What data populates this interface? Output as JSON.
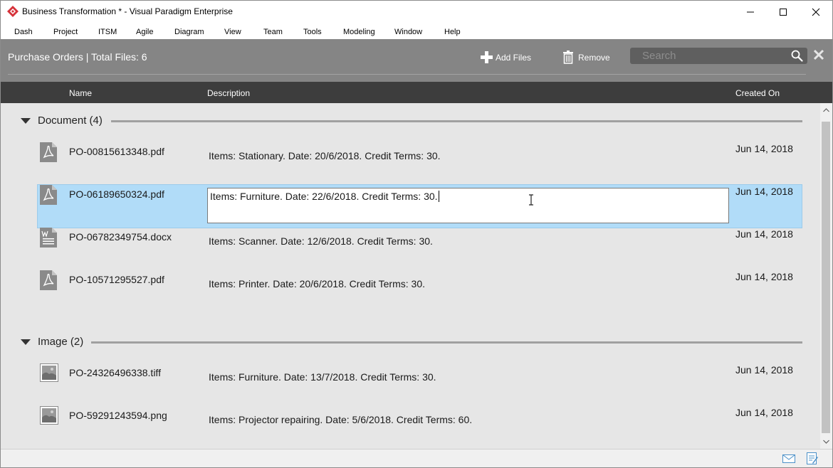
{
  "window": {
    "title": "Business Transformation * - Visual Paradigm Enterprise",
    "app_icon": "visual-paradigm-logo",
    "controls": [
      "minimize-icon",
      "maximize-icon",
      "close-icon"
    ]
  },
  "menu": [
    "Dash",
    "Project",
    "ITSM",
    "Agile",
    "Diagram",
    "View",
    "Team",
    "Tools",
    "Modeling",
    "Window",
    "Help"
  ],
  "header": {
    "title": "Purchase Orders | Total Files: 6",
    "add_files_label": "Add Files",
    "remove_label": "Remove",
    "search_placeholder": "Search",
    "search_value": ""
  },
  "columns": {
    "name": "Name",
    "description": "Description",
    "created_on": "Created On"
  },
  "groups": [
    {
      "label": "Document (4)",
      "files": [
        {
          "name": "PO-00815613348.pdf",
          "description": "Items: Stationary. Date: 20/6/2018. Credit Terms: 30.",
          "created": "Jun 14, 2018",
          "icon": "pdf-file-icon"
        },
        {
          "name": "PO-06189650324.pdf",
          "description": "Items: Furniture. Date: 22/6/2018. Credit Terms: 30.",
          "created": "Jun 14, 2018",
          "icon": "pdf-file-icon",
          "selected": true,
          "editing": true
        },
        {
          "name": "PO-06782349754.docx",
          "description": "Items: Scanner. Date: 12/6/2018. Credit Terms: 30.",
          "created": "Jun 14, 2018",
          "icon": "word-file-icon"
        },
        {
          "name": "PO-10571295527.pdf",
          "description": "Items: Printer. Date: 20/6/2018. Credit Terms: 30.",
          "created": "Jun 14, 2018",
          "icon": "pdf-file-icon"
        }
      ]
    },
    {
      "label": "Image (2)",
      "files": [
        {
          "name": "PO-24326496338.tiff",
          "description": "Items: Furniture. Date: 13/7/2018. Credit Terms: 30.",
          "created": "Jun 14, 2018",
          "icon": "image-file-icon"
        },
        {
          "name": "PO-59291243594.png",
          "description": "Items: Projector repairing. Date: 5/6/2018. Credit Terms: 60.",
          "created": "Jun 14, 2018",
          "icon": "image-file-icon"
        }
      ]
    }
  ],
  "colors": {
    "header_bg": "#858585",
    "column_header_bg": "#3d3d3d",
    "content_bg": "#e6e6e6",
    "selection_bg": "#b1dcf8",
    "brand_red": "#d6323a"
  },
  "statusbar": {
    "icons": [
      "mail-icon",
      "note-icon"
    ]
  }
}
